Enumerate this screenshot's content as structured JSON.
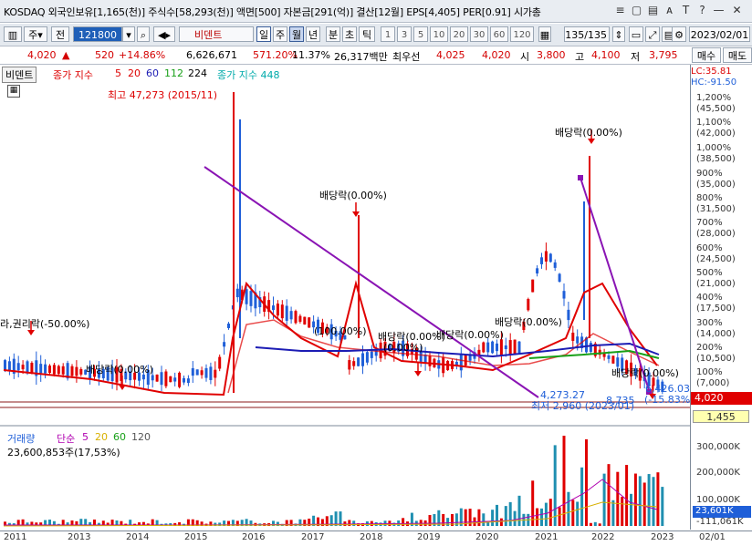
{
  "info_bar": {
    "text": "KOSDAQ 외국인보유[1,165(천)] 주식수[58,293(천)] 액면[500] 자본금[291(억)] 결산[12월] EPS[4,405] PER[0.91] 시가총",
    "icons": [
      "list-icon",
      "page-icon",
      "save-icon",
      "font-icon",
      "text-icon",
      "help-icon",
      "minimize-icon",
      "close-icon"
    ]
  },
  "toolbar": {
    "market": "주",
    "type": "전",
    "code": "121800",
    "stock_name": "비덴트",
    "periods": [
      "일",
      "주",
      "월",
      "년",
      "분",
      "초",
      "틱"
    ],
    "selected_period": "월",
    "intervals": [
      "1",
      "3",
      "5",
      "10",
      "20",
      "30",
      "60",
      "120"
    ],
    "count": "135",
    "count_total": "/135",
    "date": "2023/02/01"
  },
  "price_bar": {
    "price": "4,020",
    "change": "520",
    "change_pct": "+14.86%",
    "volume": "6,626,671",
    "vol_ratio": "571.20%",
    "turnover": "11.37%",
    "amount": "26,317백만",
    "pref_label": "최우선",
    "bid": "4,025",
    "ask": "4,020",
    "open_label": "시",
    "open": "3,800",
    "high_label": "고",
    "high": "4,100",
    "low_label": "저",
    "low": "3,795",
    "buy_btn": "매수",
    "sell_btn": "매도"
  },
  "price_legend": {
    "name": "비덴트",
    "ma_label": "종가 지수",
    "ma": [
      "5",
      "20",
      "60",
      "112",
      "224"
    ],
    "ma2_label": "종가 지수 448"
  },
  "annotations": {
    "high": "최고 47,273 (2015/11)",
    "low": "최저 2,960 (2023/01)",
    "rights": "라,권리락(-50.00%)",
    "div_2014": "배당락(0.00%)",
    "div_2017": "배당락(0.00%)",
    "pct_2017": "(100.00%)",
    "div_2018": "배당락(0.00%)",
    "pct_2018": "(0.00%)",
    "div_2019": "배당락(0.00%)",
    "div_2020": "배당락(0.00%)",
    "div_2021": "배당락(0.00%)",
    "div_2022": "배당락(0.00%)",
    "low_val": "4,273.27",
    "ma_val": "6,426.03",
    "pct_end": "(-15.83%)",
    "mid_val": "8,735"
  },
  "right_axis": {
    "lc": "LC:35.81",
    "hc": "HC:-91.50",
    "labels": [
      {
        "pct": "1,200%",
        "price": "(45,500)"
      },
      {
        "pct": "1,100%",
        "price": "(42,000)"
      },
      {
        "pct": "1,000%",
        "price": "(38,500)"
      },
      {
        "pct": "900%",
        "price": "(35,000)"
      },
      {
        "pct": "800%",
        "price": "(31,500)"
      },
      {
        "pct": "700%",
        "price": "(28,000)"
      },
      {
        "pct": "600%",
        "price": "(24,500)"
      },
      {
        "pct": "500%",
        "price": "(21,000)"
      },
      {
        "pct": "400%",
        "price": "(17,500)"
      },
      {
        "pct": "300%",
        "price": "(14,000)"
      },
      {
        "pct": "200%",
        "price": "(10,500)"
      },
      {
        "pct": "100%",
        "price": "(7,000)"
      }
    ],
    "current": "4,020",
    "box_val": "1,455",
    "vol_labels": [
      "300,000K",
      "200,000K",
      "100,000K"
    ],
    "vol_current": "23,601K",
    "vol_bottom": "-111,061K"
  },
  "volume_legend": {
    "label": "거래량",
    "ma_label": "단순",
    "ma": [
      "5",
      "20",
      "60",
      "120"
    ],
    "value": "23,600,853주(17,53%)"
  },
  "x_axis": [
    "2011",
    "2013",
    "2014",
    "2015",
    "2016",
    "2017",
    "2018",
    "2019",
    "2020",
    "2021",
    "2022",
    "2023",
    "02/01"
  ],
  "colors": {
    "up": "#e00000",
    "down": "#1f5fd8",
    "ma5": "#e00000",
    "ma60": "#1c1cb4",
    "ma112": "#18a018",
    "trend": "#8a14b4"
  }
}
